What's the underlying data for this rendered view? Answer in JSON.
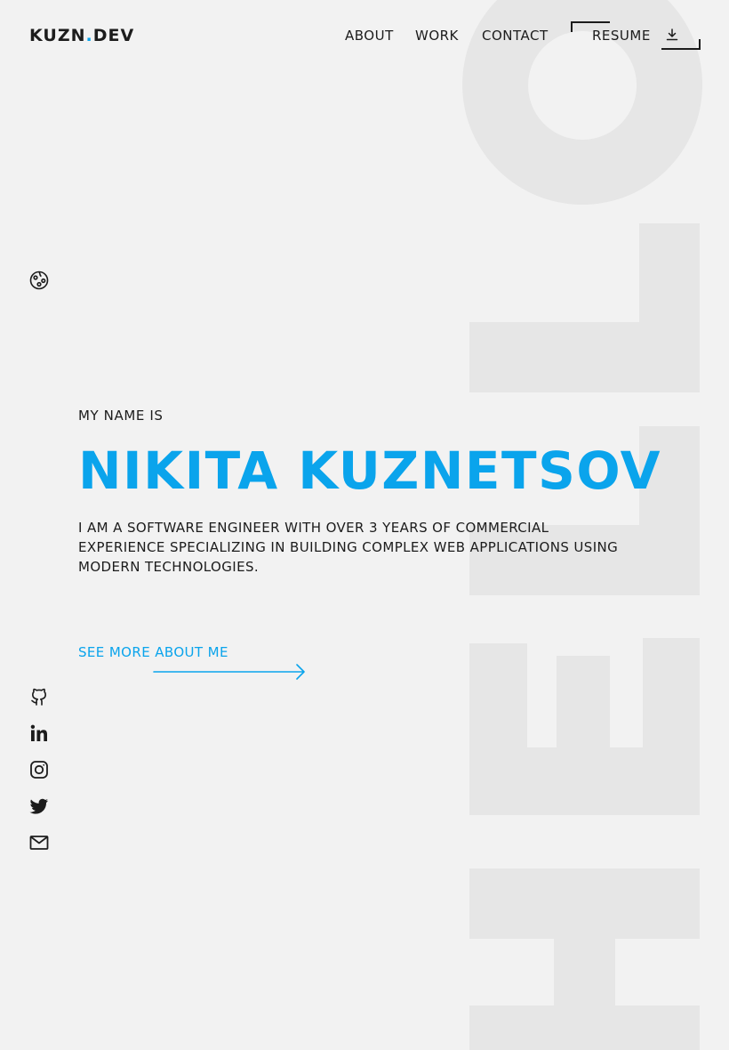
{
  "header": {
    "logo_main": "KUZN",
    "logo_dot": ".",
    "logo_suffix": "DEV",
    "nav": {
      "about": "ABOUT",
      "work": "WORK",
      "contact": "CONTACT",
      "resume": "RESUME"
    }
  },
  "hero": {
    "pre_title": "MY NAME IS",
    "name": "NIKITA KUZNETSOV",
    "description": "I AM A SOFTWARE ENGINEER WITH OVER 3 YEARS OF COMMERCIAL EXPERIENCE SPECIALIZING IN BUILDING COMPLEX WEB APPLICATIONS USING MODERN TECHNOLOGIES.",
    "cta": "SEE MORE ABOUT ME"
  },
  "icons": {
    "theme": "palette-icon",
    "download": "download-icon",
    "arrow": "arrow-right-icon",
    "socials": [
      "github-icon",
      "linkedin-icon",
      "instagram-icon",
      "twitter-icon",
      "mail-icon"
    ]
  },
  "colors": {
    "accent": "#0aa4ec",
    "background": "#f2f2f2",
    "text": "#1c1c1c",
    "decoration": "#e6e6e6"
  }
}
